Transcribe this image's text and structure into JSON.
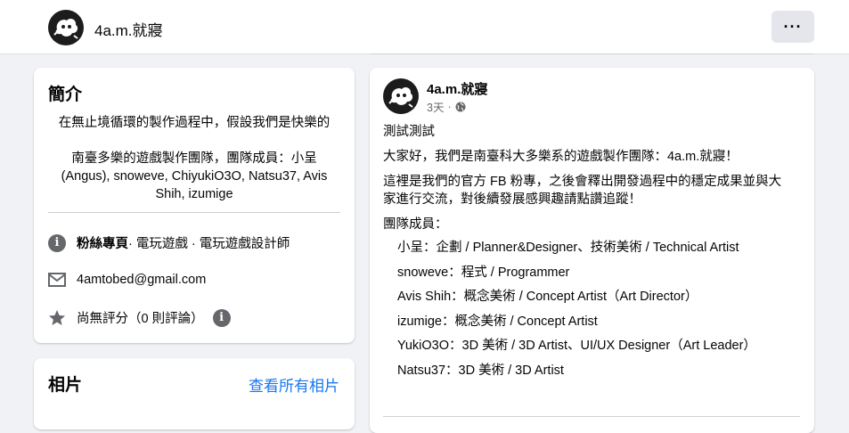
{
  "header": {
    "page_name": "4a.m.就寢",
    "more_label": "···"
  },
  "intro": {
    "title": "簡介",
    "line1": "在無止境循環的製作過程中，假設我們是快樂的",
    "line2": "南臺多樂的遊戲製作團隊，團隊成員：小呈",
    "line3": "(Angus), snoweve, ChiyukiO3O, Natsu37, Avis",
    "line4": "Shih, izumige",
    "category_bold": "粉絲專頁",
    "category_rest": " · 電玩遊戲 · 電玩遊戲設計師",
    "email": "4amtobed@gmail.com",
    "rating": "尚無評分（0 則評論）"
  },
  "photos": {
    "title": "相片",
    "see_all": "查看所有相片"
  },
  "post": {
    "author": "4a.m.就寢",
    "time": "3天",
    "lines": [
      "測試測試",
      "大家好，我們是南臺科大多樂系的遊戲製作團隊：4a.m.就寢！",
      "這裡是我們的官方 FB 粉專，之後會釋出開發過程中的穩定成果並與大",
      "家進行交流，對後續發展感興趣請點讚追蹤！",
      "團隊成員：",
      "小呈：企劃 / Planner&Designer、技術美術 / Technical Artist",
      "snoweve：程式 / Programmer",
      "Avis Shih：概念美術 / Concept Artist（Art Director）",
      "izumige：概念美術 / Concept Artist",
      "YukiO3O：3D 美術 / 3D Artist、UI/UX Designer（Art Leader）",
      "Natsu37：3D 美術 / 3D Artist"
    ]
  }
}
